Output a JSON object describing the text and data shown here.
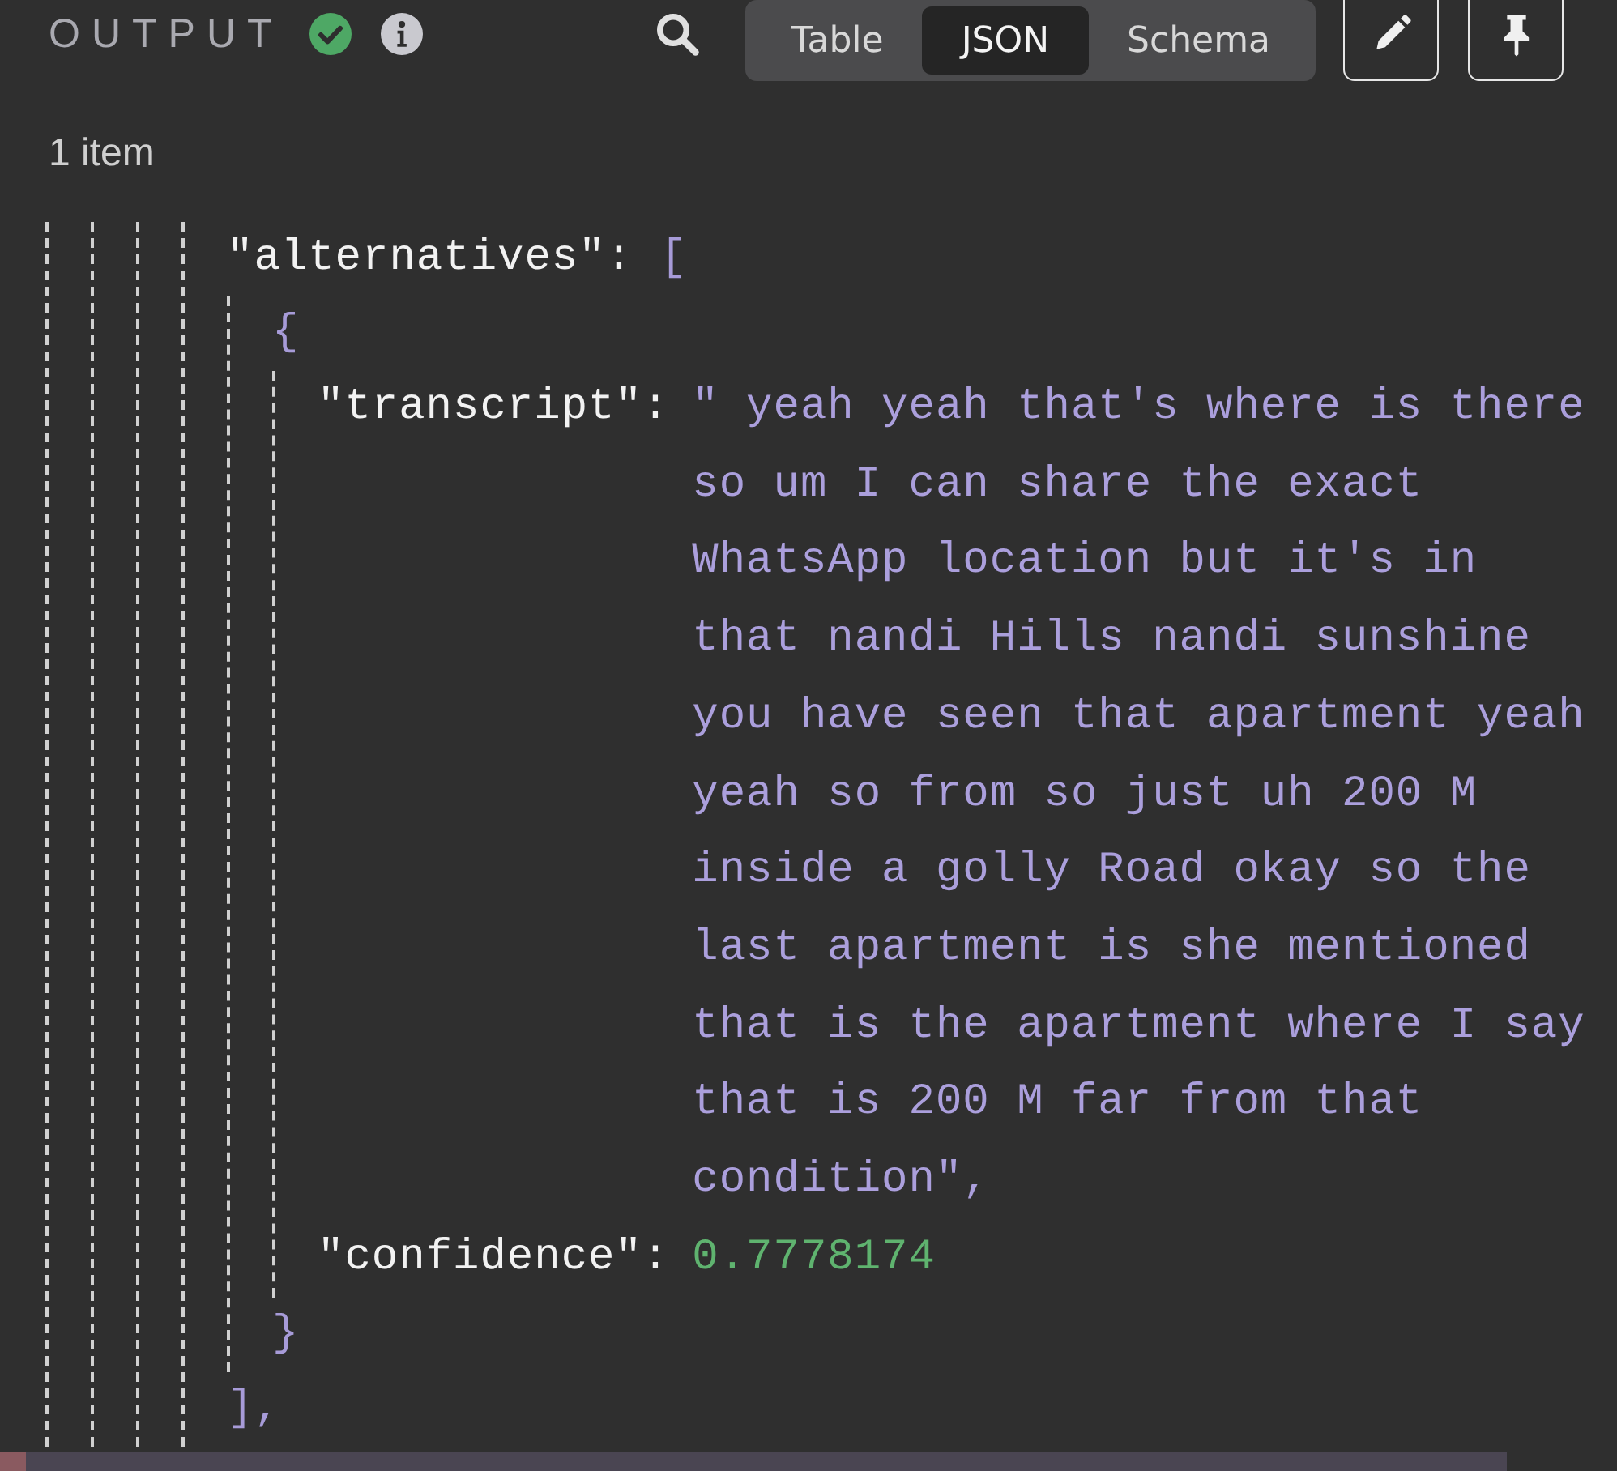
{
  "header": {
    "title": "OUTPUT",
    "tabs": [
      {
        "label": "Table",
        "selected": false
      },
      {
        "label": "JSON",
        "selected": true
      },
      {
        "label": "Schema",
        "selected": false
      }
    ]
  },
  "item_count": "1 item",
  "json_tree": [
    {
      "key": "\"alternatives\":",
      "open": "[",
      "close": "],",
      "children": [
        {
          "open": "{",
          "close": "}",
          "children": [
            {
              "key": "\"transcript\":",
              "kind": "string",
              "value_lines": [
                "\" yeah yeah that's where is there",
                "so um I can share the exact",
                "WhatsApp location but it's in",
                "that nandi Hills nandi sunshine",
                "you have seen that apartment yeah",
                "yeah so from so just uh 200 M",
                "inside a golly Road okay so the",
                "last apartment is she mentioned",
                "that is the apartment where I say",
                "that is 200 M far from that",
                "condition\","
              ]
            },
            {
              "key": "\"confidence\":",
              "kind": "number",
              "value_lines": [
                "0.7778174"
              ]
            }
          ]
        }
      ]
    }
  ]
}
